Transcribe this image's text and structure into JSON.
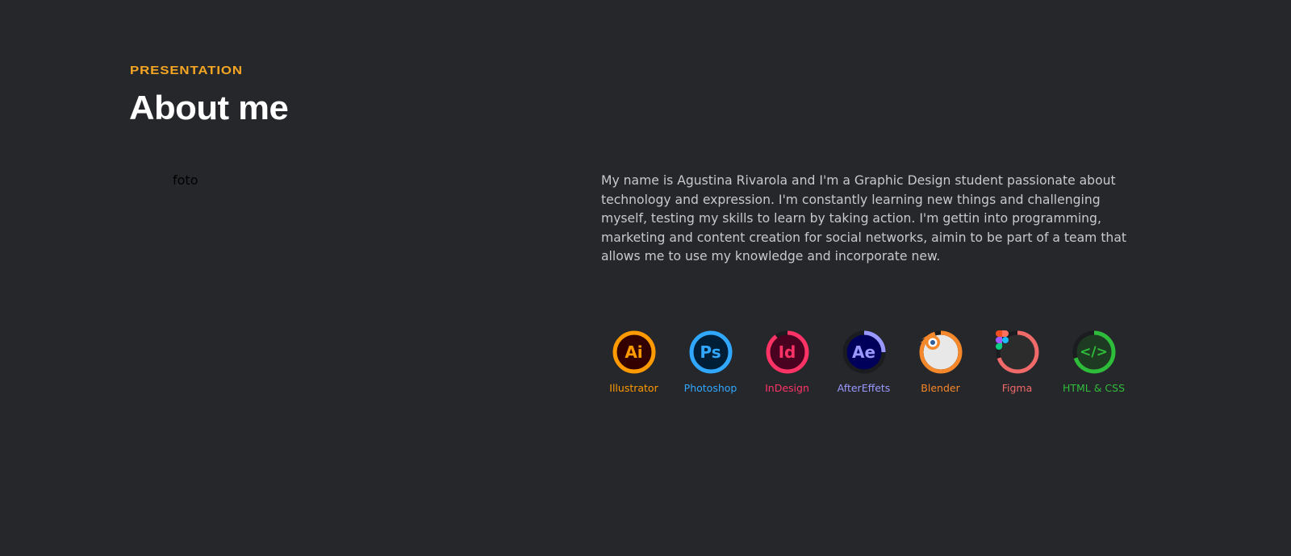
{
  "header": {
    "eyebrow": "PRESENTATION",
    "title": "About me"
  },
  "photo": {
    "placeholder_text": "foto"
  },
  "bio": {
    "text": "My name is Agustina Rivarola and I'm a Graphic Design student passionate about technology and expression. I'm constantly learning new things and challenging myself, testing my skills to learn by taking action. I'm gettin into programming, marketing and content creation for social networks, aimin to be part of a team that allows me to use my knowledge and incorporate new."
  },
  "skills": [
    {
      "label": "Illustrator",
      "glyph": "Ai",
      "icon": "illustrator-icon",
      "color": "#ff9a00",
      "fill": "#330000",
      "glyph_color": "#ff9a00",
      "level": 1.0
    },
    {
      "label": "Photoshop",
      "glyph": "Ps",
      "icon": "photoshop-icon",
      "color": "#31a8ff",
      "fill": "#001e36",
      "glyph_color": "#31a8ff",
      "level": 1.0
    },
    {
      "label": "InDesign",
      "glyph": "Id",
      "icon": "indesign-icon",
      "color": "#ff3366",
      "fill": "#49021f",
      "glyph_color": "#ff3366",
      "level": 0.9
    },
    {
      "label": "AfterEffets",
      "glyph": "Ae",
      "icon": "aftereffects-icon",
      "color": "#9999ff",
      "fill": "#00005b",
      "glyph_color": "#9999ff",
      "level": 0.25
    },
    {
      "label": "Blender",
      "glyph": "",
      "icon": "blender-icon",
      "color": "#f5882a",
      "fill": "#e8e8e8",
      "glyph_color": "#f5882a",
      "level": 0.95
    },
    {
      "label": "Figma",
      "glyph": "",
      "icon": "figma-icon",
      "color": "#f06a6a",
      "fill": "#2c2c2c",
      "glyph_color": "#f24e1e",
      "level": 0.7
    },
    {
      "label": "HTML & CSS",
      "glyph": "</>",
      "icon": "code-icon",
      "color": "#2ebd3a",
      "fill": "#1e3a22",
      "glyph_color": "#2ebd3a",
      "level": 0.7
    }
  ]
}
